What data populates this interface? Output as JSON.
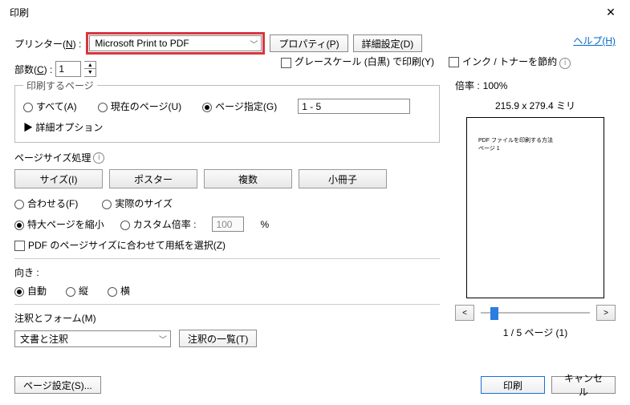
{
  "title": "印刷",
  "help_link": "ヘルプ(H)",
  "printer": {
    "label_pre": "プリンター(",
    "label_u": "N",
    "label_post": ") :",
    "selected": "Microsoft Print to PDF",
    "properties_btn": "プロパティ(P)",
    "advanced_btn": "詳細設定(D)"
  },
  "copies": {
    "label_pre": "部数(",
    "label_u": "C",
    "label_post": ") :",
    "value": "1"
  },
  "top_options": {
    "grayscale": "グレースケール (白黒) で印刷(Y)",
    "save_ink": "インク / トナーを節約"
  },
  "range": {
    "legend": "印刷するページ",
    "all": "すべて(A)",
    "current": "現在のページ(U)",
    "pages": "ページ指定(G)",
    "pages_value": "1 - 5",
    "more_options": "▶ 詳細オプション"
  },
  "size_handling": {
    "title": "ページサイズ処理",
    "tabs": {
      "size": "サイズ(I)",
      "poster": "ポスター",
      "multiple": "複数",
      "booklet": "小冊子"
    },
    "fit": "合わせる(F)",
    "actual": "実際のサイズ",
    "shrink": "特大ページを縮小",
    "custom_scale": "カスタム倍率 :",
    "custom_scale_value": "100",
    "percent": "%",
    "pdf_size_check": "PDF のページサイズに合わせて用紙を選択(Z)"
  },
  "orientation": {
    "title": "向き :",
    "auto": "自動",
    "portrait": "縦",
    "landscape": "横"
  },
  "comments_forms": {
    "title": "注釈とフォーム(M)",
    "selected": "文書と注釈",
    "summarize_btn": "注釈の一覧(T)"
  },
  "preview": {
    "scale_label": "倍率 :",
    "scale_value": "100%",
    "paper_size": "215.9 x 279.4 ミリ",
    "doc_text_1": "PDF ファイルを印刷する方法",
    "doc_text_2": "ページ 1",
    "page_indicator": "1 / 5 ページ (1)"
  },
  "footer": {
    "page_setup_btn": "ページ設定(S)...",
    "print_btn": "印刷",
    "cancel_btn": "キャンセル"
  }
}
